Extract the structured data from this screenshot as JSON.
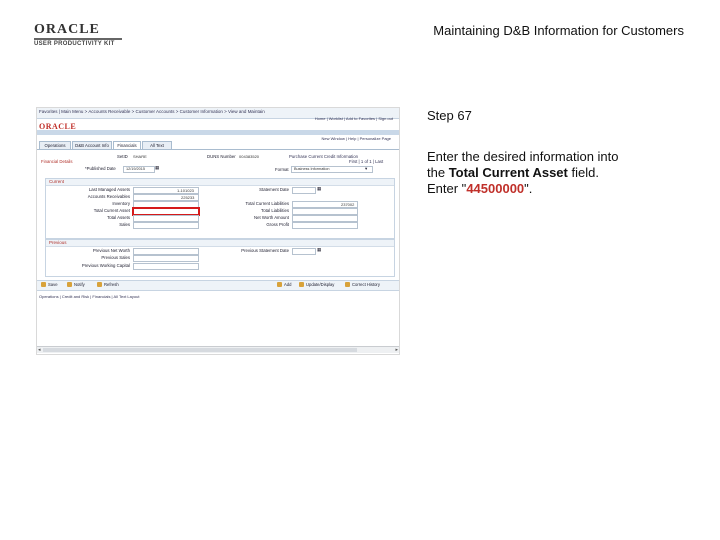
{
  "header": {
    "logo_text": "ORACLE",
    "logo_sub": "USER PRODUCTIVITY KIT",
    "doc_title": "Maintaining D&B Information for Customers"
  },
  "app": {
    "logo": "ORACLE",
    "menu": "Favorites | Main Menu > Accounts Receivable > Customer Accounts > Customer Information > View and Maintain",
    "top_links": [
      "Home",
      "Worklist",
      "Add to Favorites",
      "Sign out"
    ],
    "new_window": "New Window | Help | Personalize Page",
    "tabs": [
      "Operations",
      "D&B Account Info",
      "Financials",
      "All Text"
    ],
    "active_tab": 2,
    "setid_label": "SetID",
    "setid_value": "SHARE",
    "duns_label": "DUNS Number",
    "duns_value": "004383520",
    "purchase_link": "Purchase Current Credit Information",
    "find_line": "First | 1 of 1 | Last",
    "find_line2": "First | 1 of 1 | Last",
    "published_label": "*Published Date",
    "published_value": "12/19/2015",
    "format_label": "Format",
    "format_value": "Business Information",
    "section_current": "Current",
    "section_previous": "Previous",
    "current_left": [
      {
        "label": "Last Managed Assets",
        "value": "1-101023"
      },
      {
        "label": "Accounts Receivables",
        "value": "225233"
      },
      {
        "label": "Inventory",
        "value": ""
      },
      {
        "label": "Total Current Asset",
        "value": ""
      },
      {
        "label": "Total Assets",
        "value": ""
      },
      {
        "label": "Sales",
        "value": ""
      }
    ],
    "current_right": [
      {
        "label": "Statement Date",
        "value": ""
      },
      {
        "label": "Total Current Liabilities",
        "value": "237002"
      },
      {
        "label": "Total Liabilities",
        "value": ""
      },
      {
        "label": "Net Worth Amount",
        "value": ""
      },
      {
        "label": "Gross Profit",
        "value": ""
      }
    ],
    "previous_left": [
      "Previous Net Worth",
      "Previous Sales",
      "Previous Working Capital"
    ],
    "previous_right": [
      "Previous Statement Date"
    ],
    "buttons_left": [
      "Save",
      "Notify",
      "Refresh"
    ],
    "buttons_right": [
      "Add",
      "Update/Display",
      "Correct History"
    ],
    "footer_links": "Operations | Credit and Risk | Financials | All Text Layout"
  },
  "instructions": {
    "step": "Step 67",
    "line1": "Enter the desired information into",
    "line2_pre": "the ",
    "line2_bold": "Total Current Asset",
    "line2_post": " field.",
    "line3_pre": "Enter \"",
    "line3_value": "44500000",
    "line3_post": "\"."
  }
}
